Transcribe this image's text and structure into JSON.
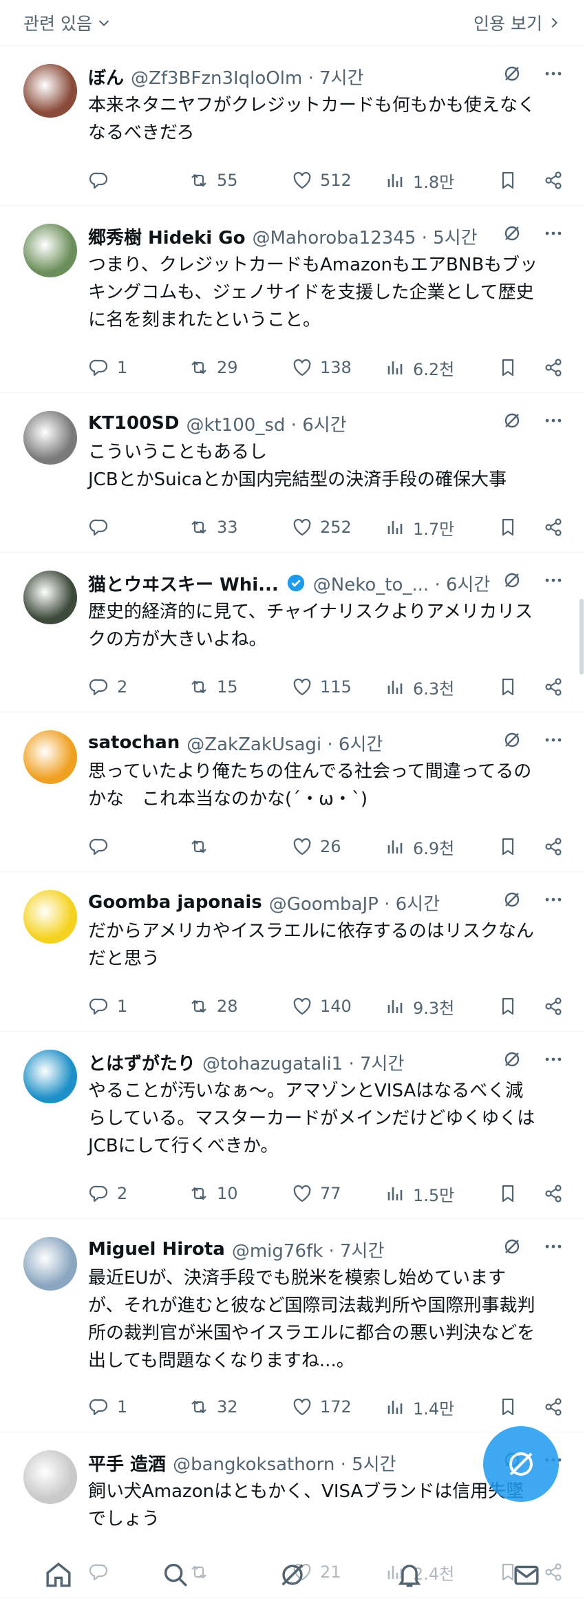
{
  "header": {
    "left_label": "관련 있음",
    "right_label": "인용 보기"
  },
  "tweets": [
    {
      "name": "ぼん",
      "handle": "@Zf3BFzn3IqloOlm · 7시간",
      "text": "本来ネタニヤフがクレジットカードも何もかも使えなく\nなるべきだろ",
      "reply": "",
      "retweet": "55",
      "like": "512",
      "views": "1.8만",
      "height": 232,
      "avatar_color": "#8a4b3a"
    },
    {
      "name": "郷秀樹 Hideki Go",
      "handle": "@Mahoroba12345 · 5시간",
      "text": "つまり、クレジットカードもAmazonもエアBNBもブッ\nキングコムも、ジェノサイドを支援した企業として歴史\nに名を刻まれたということ。",
      "reply": "1",
      "retweet": "29",
      "like": "138",
      "views": "6.2천",
      "height": 272,
      "avatar_color": "#6b8f5a"
    },
    {
      "name": "KT100SD",
      "handle": "@kt100_sd · 6시간",
      "text": "こういうこともあるし\nJCBとかSuicaとか国内完結型の決済手段の確保大事",
      "reply": "",
      "retweet": "33",
      "like": "252",
      "views": "1.7만",
      "height": 232,
      "avatar_color": "#7a7a7a"
    },
    {
      "name": "猫とウヰスキー Whi...",
      "handle": "@Neko_to_... · 6시간",
      "text": "歴史的経済的に見て、チャイナリスクよりアメリカリス\nクの方が大きいよね。",
      "reply": "2",
      "retweet": "15",
      "like": "115",
      "views": "6.3천",
      "height": 232,
      "avatar_color": "#3d4a3a",
      "verified": true
    },
    {
      "name": "satochan",
      "handle": "@ZakZakUsagi · 6시간",
      "text": "思っていたより俺たちの住んでる社会って間違ってるの\nかな　これ本当なのかな(´・ω・`)",
      "reply": "",
      "retweet": "",
      "like": "26",
      "views": "6.9천",
      "height": 232,
      "avatar_color": "#f0a020"
    },
    {
      "name": "Goomba japonais",
      "handle": "@GoombaJP · 6시간",
      "text": "だからアメリカやイスラエルに依存するのはリスクなん\nだと思う",
      "reply": "1",
      "retweet": "28",
      "like": "140",
      "views": "9.3천",
      "height": 232,
      "avatar_color": "#f5d21f"
    },
    {
      "name": "とはずがたり",
      "handle": "@tohazugatali1 · 7시간",
      "text": "やることが汚いなぁ〜。アマゾンとVISAはなるべく減\nらしている。マスターカードがメインだけどゆくゆくは\nJCBにして行くべきか。",
      "reply": "2",
      "retweet": "10",
      "like": "77",
      "views": "1.5만",
      "height": 272,
      "avatar_color": "#1e90c8"
    },
    {
      "name": "Miguel Hirota",
      "handle": "@mig76fk · 7시간",
      "text": "最近EUが、決済手段でも脱米を模索し始めています\nが、それが進むと彼など国際司法裁判所や国際刑事裁判\n所の裁判官が米国やイスラエルに都合の悪い判決などを\n出しても問題なくなりますね...。",
      "reply": "1",
      "retweet": "32",
      "like": "172",
      "views": "1.4만",
      "height": 310,
      "avatar_color": "#8aa6c0"
    },
    {
      "name": "平手 造酒",
      "handle": "@bangkoksathorn · 5시간",
      "text": "飼い犬Amazonはともかく、VISAブランドは信用失墜\nでしょう",
      "reply": "",
      "retweet": "",
      "like": "21",
      "views": "2.4천",
      "height": 240,
      "avatar_color": "#c9c9c9"
    }
  ],
  "icons": {
    "reply": "reply-icon",
    "retweet": "retweet-icon",
    "like": "heart-icon",
    "views": "views-icon",
    "bookmark": "bookmark-icon",
    "share": "share-icon",
    "grok": "grok-icon",
    "more": "more-icon"
  },
  "colors": {
    "accent": "#1d9bf0",
    "text": "#0f1419",
    "muted": "#536471",
    "border": "#eff3f4"
  }
}
